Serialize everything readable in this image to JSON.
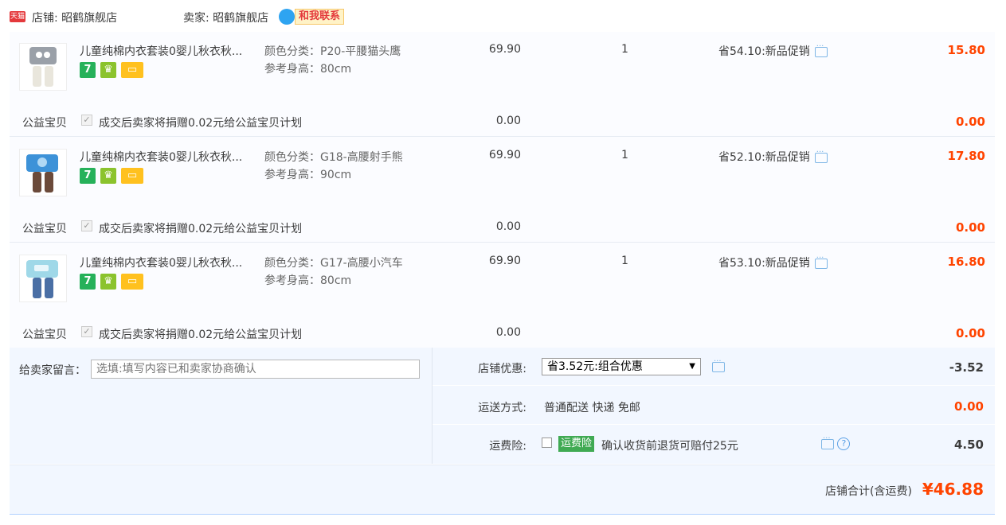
{
  "header": {
    "tmall_badge": "天猫",
    "shop": "店铺: 昭鹤旗舰店",
    "seller": "卖家: 昭鹤旗舰店",
    "contact": "和我联系"
  },
  "items": [
    {
      "title": "儿童纯棉内衣套装0婴儿秋衣秋...",
      "sku_color": "颜色分类：P20-平腰猫头鹰",
      "sku_height": "参考身高：80cm",
      "price": "69.90",
      "qty": "1",
      "promo": "省54.10:新品促销",
      "subtotal": "15.80",
      "colors": {
        "top": "#9aa0a8",
        "bottom": "#e9e6dc"
      }
    },
    {
      "title": "儿童纯棉内衣套装0婴儿秋衣秋...",
      "sku_color": "颜色分类：G18-高腰射手熊",
      "sku_height": "参考身高：90cm",
      "price": "69.90",
      "qty": "1",
      "promo": "省52.10:新品促销",
      "subtotal": "17.80",
      "colors": {
        "top": "#3d92d8",
        "bottom": "#6b4a3a"
      }
    },
    {
      "title": "儿童纯棉内衣套装0婴儿秋衣秋...",
      "sku_color": "颜色分类：G17-高腰小汽车",
      "sku_height": "参考身高：80cm",
      "price": "69.90",
      "qty": "1",
      "promo": "省53.10:新品促销",
      "subtotal": "16.80",
      "colors": {
        "top": "#9fd8e8",
        "bottom": "#4a6fa5"
      }
    }
  ],
  "charity": {
    "label": "公益宝贝",
    "text": "成交后卖家将捐赠0.02元给公益宝贝计划",
    "price": "0.00",
    "subtotal": "0.00",
    "check_mark": "✓"
  },
  "message": {
    "label": "给卖家留言：",
    "placeholder": "选填:填写内容已和卖家协商确认"
  },
  "options": {
    "discount_label": "店铺优惠:",
    "discount_value": "省3.52元:组合优惠",
    "discount_amount": "-3.52",
    "shipping_label": "运送方式:",
    "shipping_value": "普通配送 快递 免邮",
    "shipping_amount": "0.00",
    "insurance_label": "运费险:",
    "insurance_badge": "运费险",
    "insurance_text": "确认收货前退货可赔付25元",
    "insurance_amount": "4.50",
    "help": "?"
  },
  "total": {
    "label": "店铺合计(含运费)",
    "value": "¥46.88"
  },
  "accent": "#ff4400"
}
